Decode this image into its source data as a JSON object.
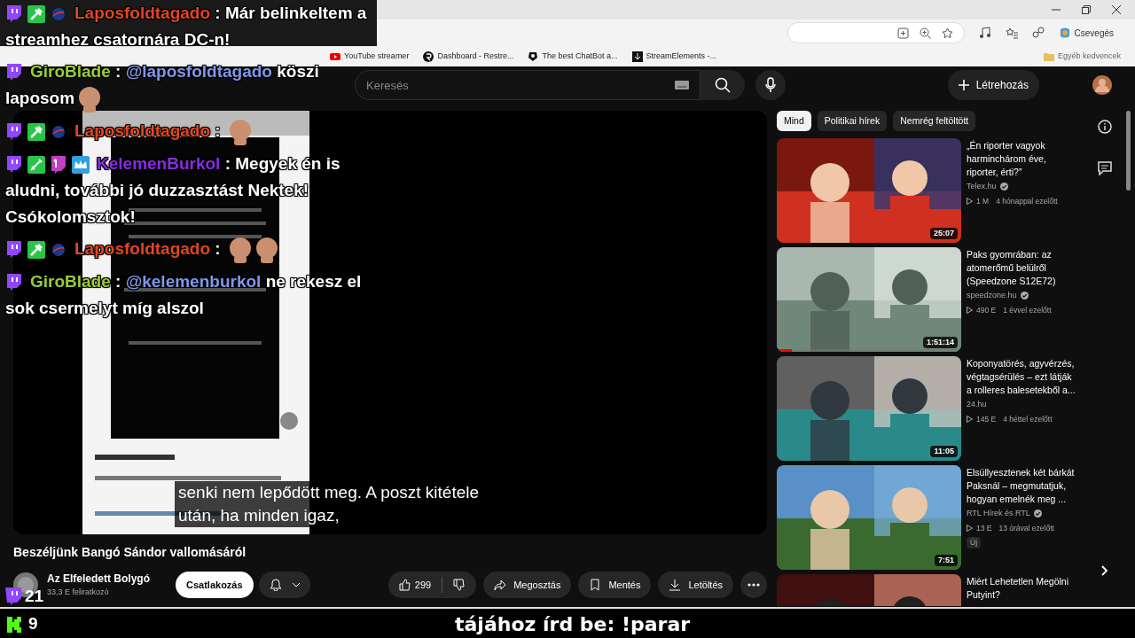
{
  "browser": {
    "bookmarks": [
      {
        "label": "YouTube streamer",
        "kind": "youtube"
      },
      {
        "label": "Dashboard - Restre...",
        "kind": "restream"
      },
      {
        "label": "The best ChatBot a...",
        "kind": "chatbot"
      },
      {
        "label": "StreamElements -...",
        "kind": "streamelements"
      }
    ],
    "copilot_label": "Csevegés",
    "other_bookmarks": "Egyéb kedvencek"
  },
  "youtube": {
    "search": {
      "placeholder": "Keresés"
    },
    "create_button": "Létrehozás",
    "caption": [
      "senki nem lepődött meg. A poszt kitétele",
      "után, ha minden igaz,"
    ],
    "video_title": "Beszéljünk Bangó Sándor vallomásáról",
    "channel": {
      "name": "Az Elfeledett Bolygó",
      "subscribers": "33,3 E feliratkozó",
      "join_button": "Csatlakozás"
    },
    "actions": {
      "likes": "299",
      "share": "Megosztás",
      "save": "Mentés",
      "download": "Letöltés"
    },
    "chips": [
      {
        "label": "Mind",
        "selected": true
      },
      {
        "label": "Politikai hírek",
        "selected": false
      },
      {
        "label": "Nemrég feltöltött",
        "selected": false
      }
    ],
    "related": [
      {
        "title": "„Én riporter vagyok harminchárom éve, riporter, érti?”",
        "channel": "Telex.hu",
        "verified": true,
        "views": "1 M",
        "age": "4 hónappal ezelőtt",
        "duration": "25:07"
      },
      {
        "title": "Paks gyomrában: az atomerőmű belülről (Speedzone S12E72)",
        "channel": "speedzone.hu",
        "verified": true,
        "views": "490 E",
        "age": "1 évvel ezelőtt",
        "duration": "1:51:14",
        "level": 0.08
      },
      {
        "title": "Koponyatörés, agyvérzés, végtagsérülés – ezt látják a rolleres balesetekből a...",
        "channel": "24.hu",
        "verified": false,
        "views": "145 E",
        "age": "4 héttel ezelőtt",
        "duration": "11:05"
      },
      {
        "title": "Elsüllyesztenek két bárkát Paksnál – megmutatjuk, hogyan emelnék meg ...",
        "channel": "RTL Hírek és RTL",
        "verified": true,
        "views": "13 E",
        "age": "13 órával ezelőtt",
        "duration": "7:51",
        "badge": "Új"
      },
      {
        "title": "Miért Lehetetlen Megölni Putyint?"
      }
    ]
  },
  "chat": [
    {
      "badges": [
        {
          "kind": "twitch"
        },
        {
          "kind": "tool"
        },
        {
          "kind": "nasa"
        }
      ],
      "user": "Laposfoldtagado",
      "color": "#e2461f",
      "separator": ":",
      "text": "Már belinkeltem a streamhez csatornára DC-n!"
    },
    {
      "badges": [
        {
          "kind": "twitch"
        }
      ],
      "user": "GiroBlade",
      "color": "#9acd32",
      "separator": ":",
      "mention": "@laposfoldtagado",
      "text": "köszi laposom",
      "emotes": [
        {
          "kind": "figure"
        }
      ]
    },
    {
      "badges": [
        {
          "kind": "twitch"
        },
        {
          "kind": "tool"
        },
        {
          "kind": "nasa"
        }
      ],
      "user": "Laposfoldtagado",
      "color": "#e2461f",
      "separator": ":",
      "emotes": [
        {
          "kind": "figure"
        }
      ]
    },
    {
      "badges": [
        {
          "kind": "twitch"
        },
        {
          "kind": "sword"
        },
        {
          "kind": "first"
        },
        {
          "kind": "crown"
        }
      ],
      "user": "KelemenBurkol",
      "color": "#8a2be2",
      "separator": ":",
      "text": "Megyek én is aludni, további jó duzzasztást Nektek! Csókolomsztok!"
    },
    {
      "badges": [
        {
          "kind": "twitch"
        },
        {
          "kind": "tool"
        },
        {
          "kind": "nasa"
        }
      ],
      "user": "Laposfoldtagado",
      "color": "#e2461f",
      "separator": ":",
      "emotes": [
        {
          "kind": "figure"
        },
        {
          "kind": "figure"
        }
      ]
    },
    {
      "badges": [
        {
          "kind": "twitch"
        }
      ],
      "user": "GiroBlade",
      "color": "#9acd32",
      "separator": ":",
      "mention": "@kelemenburkol",
      "text": "ne rekesz el sok csermelyt míg alszol"
    }
  ],
  "viewers": {
    "twitch": "21",
    "kick": "9"
  },
  "ticker": "tájához írd be: !parar"
}
